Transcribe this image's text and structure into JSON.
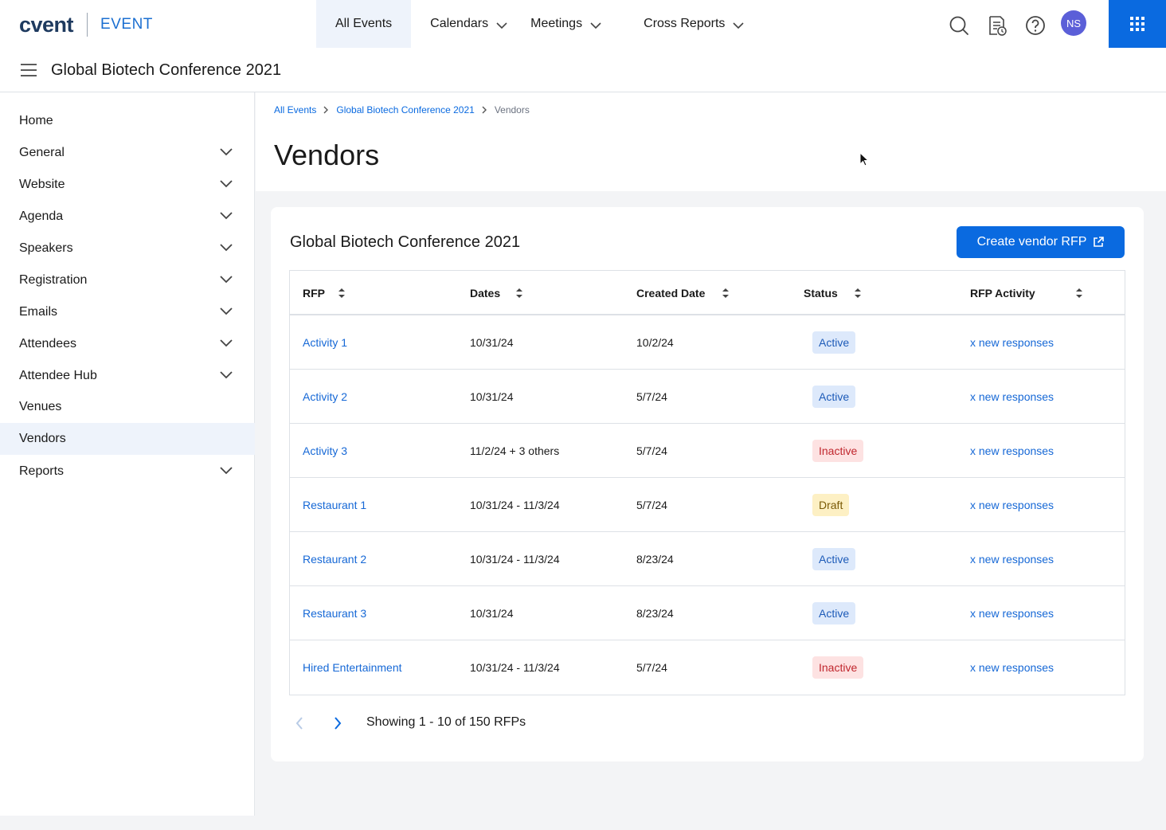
{
  "brand": {
    "logo": "cvent",
    "product": "EVENT"
  },
  "nav": {
    "items": [
      {
        "label": "All Events"
      },
      {
        "label": "Calendars"
      },
      {
        "label": "Meetings"
      },
      {
        "label": "Cross Reports"
      }
    ],
    "user_initials": "NS"
  },
  "event": {
    "title": "Global Biotech Conference 2021"
  },
  "sidebar": {
    "items": [
      {
        "label": "Home"
      },
      {
        "label": "General"
      },
      {
        "label": "Website"
      },
      {
        "label": "Agenda"
      },
      {
        "label": "Speakers"
      },
      {
        "label": "Registration"
      },
      {
        "label": "Emails"
      },
      {
        "label": "Attendees"
      },
      {
        "label": "Attendee Hub"
      },
      {
        "label": "Venues"
      },
      {
        "label": "Vendors"
      },
      {
        "label": "Reports"
      }
    ]
  },
  "breadcrumb": {
    "root": "All Events",
    "event": "Global Biotech Conference 2021",
    "current": "Vendors"
  },
  "page": {
    "title": "Vendors"
  },
  "card": {
    "title": "Global Biotech Conference 2021",
    "create_label": "Create vendor RFP"
  },
  "table": {
    "headers": [
      "RFP",
      "Dates",
      "Created Date",
      "Status",
      "RFP Activity"
    ],
    "rows": [
      {
        "rfp": "Activity 1",
        "dates": "10/31/24",
        "created": "10/2/24",
        "status": "Active",
        "activity": "x new responses"
      },
      {
        "rfp": "Activity 2",
        "dates": "10/31/24",
        "created": "5/7/24",
        "status": "Active",
        "activity": "x new responses"
      },
      {
        "rfp": "Activity 3",
        "dates": "11/2/24 + 3 others",
        "created": "5/7/24",
        "status": "Inactive",
        "activity": "x new responses"
      },
      {
        "rfp": "Restaurant 1",
        "dates": "10/31/24 - 11/3/24",
        "created": "5/7/24",
        "status": "Draft",
        "activity": "x new responses"
      },
      {
        "rfp": "Restaurant 2",
        "dates": "10/31/24 - 11/3/24",
        "created": "8/23/24",
        "status": "Active",
        "activity": "x new responses"
      },
      {
        "rfp": "Restaurant 3",
        "dates": "10/31/24",
        "created": "8/23/24",
        "status": "Active",
        "activity": "x new responses"
      },
      {
        "rfp": "Hired Entertainment",
        "dates": "10/31/24 - 11/3/24",
        "created": "5/7/24",
        "status": "Inactive",
        "activity": "x new responses"
      }
    ]
  },
  "pagination": {
    "summary": "Showing 1 - 10 of 150 RFPs"
  },
  "colors": {
    "accent": "#0a6ae0",
    "active_bg": "#dde9fb",
    "inactive_bg": "#fde2e2",
    "draft_bg": "#fdf0c4"
  }
}
